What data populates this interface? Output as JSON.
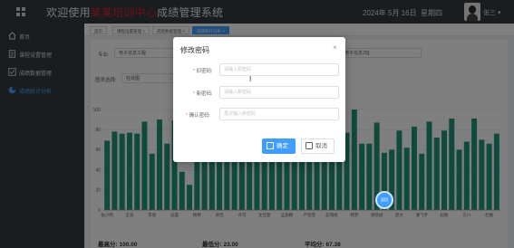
{
  "header": {
    "title_prefix": "欢迎使用",
    "title_highlight": "某某培训中心",
    "title_suffix": "成绩管理系统",
    "date": "2024年 5月 16日",
    "weekday": "星期四",
    "user": "张三 ▾"
  },
  "sidebar": {
    "items": [
      {
        "label": "首页",
        "icon": "home-icon"
      },
      {
        "label": "课程设置管理",
        "icon": "document-icon"
      },
      {
        "label": "成绩数据管理",
        "icon": "checklist-icon"
      },
      {
        "label": "成绩统计分析",
        "icon": "chart-icon"
      }
    ],
    "active_index": 3
  },
  "tabs": [
    {
      "label": "首页"
    },
    {
      "label": "课程设置管理 ×"
    },
    {
      "label": "成绩数据管理 ×"
    },
    {
      "label": "成绩统计分析 ×"
    }
  ],
  "filters": {
    "major_label": "专业:",
    "major_value": "电子信息工程",
    "class_value": "电子信息2班",
    "chart_type_label": "图表选择:",
    "chart_type_value": "柱状图"
  },
  "modal": {
    "title": "修改密码",
    "close": "×",
    "fields": [
      {
        "label": "旧密码:",
        "placeholder": "请输入原密码"
      },
      {
        "label": "新密码:",
        "placeholder": "请输入新密码"
      },
      {
        "label": "确认密码:",
        "placeholder": "再次输入新密码"
      }
    ],
    "required_mark": "*",
    "ok_label": "确定",
    "cancel_label": "取消"
  },
  "chart_data": {
    "type": "bar",
    "ylim": [
      0,
      100
    ],
    "yticks": [
      0,
      20,
      40,
      60,
      80,
      100
    ],
    "x_tick_labels": [
      {
        "index": 0,
        "label": "张小明"
      },
      {
        "index": 3,
        "label": "王浩"
      },
      {
        "index": 6,
        "label": "李丽"
      },
      {
        "index": 9,
        "label": "吴晨"
      },
      {
        "index": 12,
        "label": "杨柳"
      },
      {
        "index": 15,
        "label": "郑佳"
      },
      {
        "index": 18,
        "label": "许可"
      },
      {
        "index": 21,
        "label": "沈佳慧"
      },
      {
        "index": 24,
        "label": "孟丽娜"
      },
      {
        "index": 27,
        "label": "严瑞雪"
      },
      {
        "index": 30,
        "label": "彭晓帆"
      },
      {
        "index": 33,
        "label": "韩梦"
      },
      {
        "index": 36,
        "label": "谢晓斌"
      },
      {
        "index": 39,
        "label": "邵文"
      },
      {
        "index": 42,
        "label": "潘飞宇"
      },
      {
        "index": 45,
        "label": "赵颖"
      },
      {
        "index": 48,
        "label": "方川"
      },
      {
        "index": 51,
        "label": "杜敏"
      }
    ],
    "values": [
      69,
      78,
      76,
      77,
      76,
      88,
      56,
      90,
      66,
      89,
      38,
      25,
      49,
      95,
      60,
      98,
      72,
      55,
      89,
      92,
      61,
      86,
      57,
      64,
      80,
      60,
      70,
      55,
      80,
      63,
      66,
      95,
      77,
      100,
      66,
      66,
      87,
      57,
      60,
      79,
      62,
      83,
      56,
      88,
      72,
      79,
      91,
      60,
      68,
      91,
      70,
      66,
      76
    ],
    "bar_color": "#20957a"
  },
  "stats": {
    "max": "最高分: 100.00",
    "min": "最低分: 23.00",
    "avg": "平均分: 67.38"
  },
  "float_button": "返回"
}
